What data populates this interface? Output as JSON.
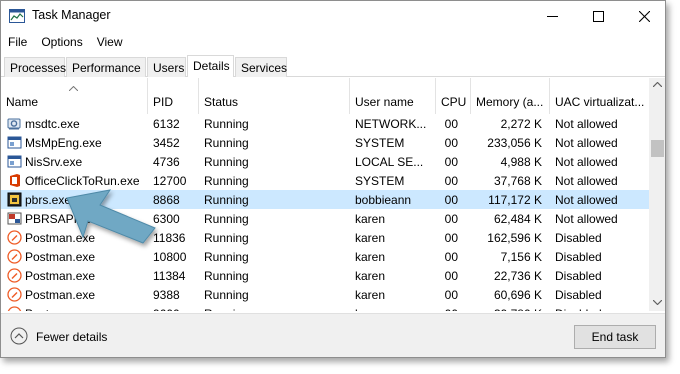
{
  "window": {
    "title": "Task Manager"
  },
  "menu": [
    "File",
    "Options",
    "View"
  ],
  "tabs": [
    {
      "label": "Processes",
      "active": false
    },
    {
      "label": "Performance",
      "active": false
    },
    {
      "label": "Users",
      "active": false
    },
    {
      "label": "Details",
      "active": true
    },
    {
      "label": "Services",
      "active": false
    }
  ],
  "columns": {
    "name": "Name",
    "pid": "PID",
    "status": "Status",
    "user": "User name",
    "cpu": "CPU",
    "memory": "Memory (a...",
    "uac": "UAC virtualizat..."
  },
  "rows": [
    {
      "icon": "gear-network-icon",
      "name": "msdtc.exe",
      "pid": "6132",
      "status": "Running",
      "user": "NETWORK...",
      "cpu": "00",
      "memory": "2,272 K",
      "uac": "Not allowed",
      "selected": false
    },
    {
      "icon": "window-app-icon",
      "name": "MsMpEng.exe",
      "pid": "3452",
      "status": "Running",
      "user": "SYSTEM",
      "cpu": "00",
      "memory": "233,056 K",
      "uac": "Not allowed",
      "selected": false
    },
    {
      "icon": "window-app-icon",
      "name": "NisSrv.exe",
      "pid": "4736",
      "status": "Running",
      "user": "LOCAL SE...",
      "cpu": "00",
      "memory": "4,988 K",
      "uac": "Not allowed",
      "selected": false
    },
    {
      "icon": "office-icon",
      "name": "OfficeClickToRun.exe",
      "pid": "12700",
      "status": "Running",
      "user": "SYSTEM",
      "cpu": "00",
      "memory": "37,768 K",
      "uac": "Not allowed",
      "selected": false
    },
    {
      "icon": "pbrs-icon",
      "name": "pbrs.exe",
      "pid": "8868",
      "status": "Running",
      "user": "bobbieann",
      "cpu": "00",
      "memory": "117,172 K",
      "uac": "Not allowed",
      "selected": true
    },
    {
      "icon": "pbrs-api-icon",
      "name": "PBRSAPIService",
      "pid": "6300",
      "status": "Running",
      "user": "karen",
      "cpu": "00",
      "memory": "62,484 K",
      "uac": "Not allowed",
      "selected": false
    },
    {
      "icon": "postman-icon",
      "name": "Postman.exe",
      "pid": "11836",
      "status": "Running",
      "user": "karen",
      "cpu": "00",
      "memory": "162,596 K",
      "uac": "Disabled",
      "selected": false
    },
    {
      "icon": "postman-icon",
      "name": "Postman.exe",
      "pid": "10800",
      "status": "Running",
      "user": "karen",
      "cpu": "00",
      "memory": "7,156 K",
      "uac": "Disabled",
      "selected": false
    },
    {
      "icon": "postman-icon",
      "name": "Postman.exe",
      "pid": "11384",
      "status": "Running",
      "user": "karen",
      "cpu": "00",
      "memory": "22,736 K",
      "uac": "Disabled",
      "selected": false
    },
    {
      "icon": "postman-icon",
      "name": "Postman.exe",
      "pid": "9388",
      "status": "Running",
      "user": "karen",
      "cpu": "00",
      "memory": "60,696 K",
      "uac": "Disabled",
      "selected": false
    },
    {
      "icon": "postman-icon",
      "name": "Postman.exe",
      "pid": "9600",
      "status": "Running",
      "user": "karen",
      "cpu": "00",
      "memory": "39,780 K",
      "uac": "Disabled",
      "selected": false
    }
  ],
  "footer": {
    "fewer_details": "Fewer details",
    "end_task": "End task"
  },
  "colors": {
    "selection": "#cce8ff",
    "annotation_arrow": "#6fa8c4",
    "postman": "#ef5b25",
    "office": "#d83b01"
  }
}
